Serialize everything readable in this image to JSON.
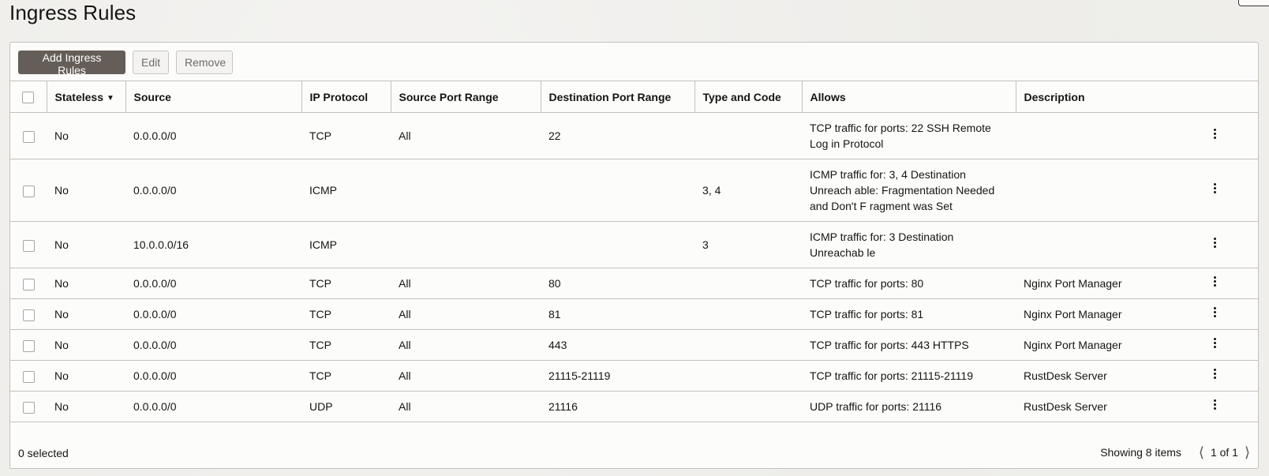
{
  "page": {
    "title": "Ingress Rules"
  },
  "toolbar": {
    "add_label": "Add Ingress Rules",
    "edit_label": "Edit",
    "remove_label": "Remove"
  },
  "table": {
    "columns": [
      "Stateless",
      "Source",
      "IP Protocol",
      "Source Port Range",
      "Destination Port Range",
      "Type and Code",
      "Allows",
      "Description"
    ],
    "sort": {
      "column": "Stateless",
      "direction": "descending",
      "icon": "caret-down-icon"
    },
    "rows": [
      {
        "stateless": "No",
        "source": "0.0.0.0/0",
        "protocol": "TCP",
        "source_port": "All",
        "dest_port": "22",
        "type_code": "",
        "allows": "TCP traffic for ports: 22 SSH Remote Log in Protocol",
        "description": ""
      },
      {
        "stateless": "No",
        "source": "0.0.0.0/0",
        "protocol": "ICMP",
        "source_port": "",
        "dest_port": "",
        "type_code": "3, 4",
        "allows": "ICMP traffic for: 3, 4 Destination Unreach able: Fragmentation Needed and Don't F ragment was Set",
        "description": ""
      },
      {
        "stateless": "No",
        "source": "10.0.0.0/16",
        "protocol": "ICMP",
        "source_port": "",
        "dest_port": "",
        "type_code": "3",
        "allows": "ICMP traffic for: 3 Destination Unreachab le",
        "description": ""
      },
      {
        "stateless": "No",
        "source": "0.0.0.0/0",
        "protocol": "TCP",
        "source_port": "All",
        "dest_port": "80",
        "type_code": "",
        "allows": "TCP traffic for ports: 80",
        "description": "Nginx Port Manager"
      },
      {
        "stateless": "No",
        "source": "0.0.0.0/0",
        "protocol": "TCP",
        "source_port": "All",
        "dest_port": "81",
        "type_code": "",
        "allows": "TCP traffic for ports: 81",
        "description": "Nginx Port Manager"
      },
      {
        "stateless": "No",
        "source": "0.0.0.0/0",
        "protocol": "TCP",
        "source_port": "All",
        "dest_port": "443",
        "type_code": "",
        "allows": "TCP traffic for ports: 443 HTTPS",
        "description": "Nginx Port Manager"
      },
      {
        "stateless": "No",
        "source": "0.0.0.0/0",
        "protocol": "TCP",
        "source_port": "All",
        "dest_port": "21115-21119",
        "type_code": "",
        "allows": "TCP traffic for ports: 21115-21119",
        "description": "RustDesk Server"
      },
      {
        "stateless": "No",
        "source": "0.0.0.0/0",
        "protocol": "UDP",
        "source_port": "All",
        "dest_port": "21116",
        "type_code": "",
        "allows": "UDP traffic for ports: 21116",
        "description": "RustDesk Server"
      }
    ]
  },
  "footer": {
    "selected_text": "0 selected",
    "showing_text": "Showing 8 items",
    "page_text": "1 of 1"
  },
  "colors": {
    "primary_button": "#655e58",
    "border": "#c4c1bc",
    "background": "#f0efec",
    "card": "#fcfcfb",
    "text": "#161513"
  }
}
